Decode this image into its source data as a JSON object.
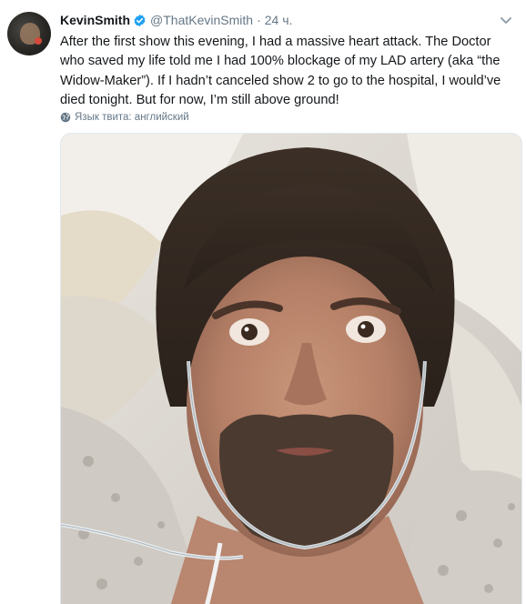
{
  "author": {
    "display_name": "KevinSmith",
    "handle": "@ThatKevinSmith",
    "separator": "·",
    "time": "24 ч."
  },
  "tweet": {
    "text": "After the first show this evening, I had a massive heart attack. The Doctor who saved my life told me I had 100% blockage of my LAD artery (aka “the Widow-Maker”). If I hadn’t canceled show 2 to go to the hospital, I would’ve died tonight. But for now, I’m still above ground!",
    "language_label": "Язык твита: английский"
  },
  "colors": {
    "verified": "#1da1f2",
    "secondary_text": "#657786",
    "primary_text": "#14171a"
  },
  "icons": {
    "verified": "verified-badge-icon",
    "menu": "chevron-down-icon",
    "language": "globe-icon"
  }
}
